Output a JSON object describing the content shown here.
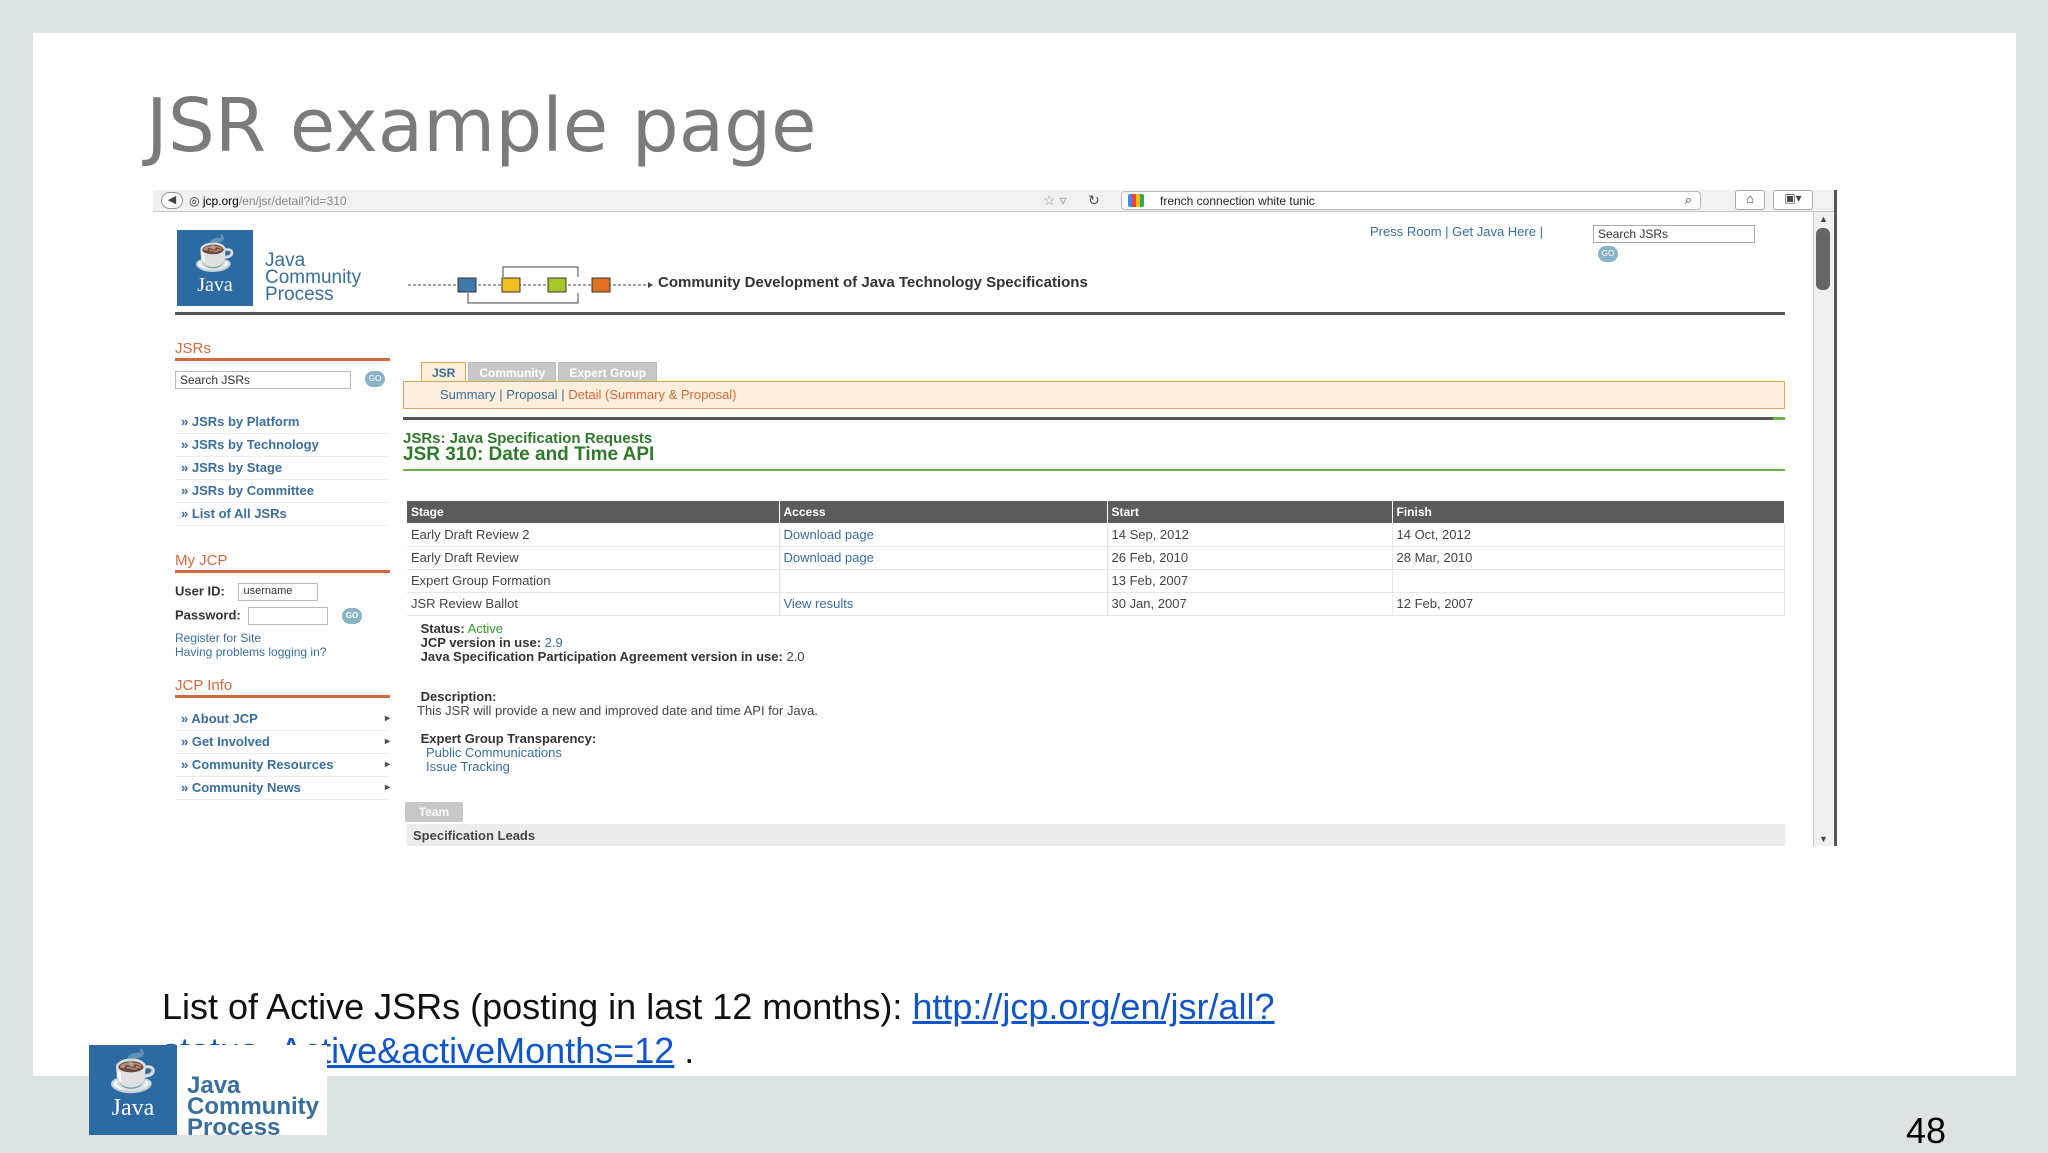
{
  "slide": {
    "title": "JSR example page",
    "page_number": "48",
    "caption_text": "List of Active JSRs (posting in last 12 months): ",
    "caption_link": "http://jcp.org/en/jsr/all?status=Active&activeMonths=12",
    "caption_end": " ."
  },
  "browser": {
    "url_host": "jcp.org",
    "url_path": "/en/jsr/detail?id=310",
    "search_query": "french connection white tunic"
  },
  "jcp": {
    "logo_text": "Java",
    "logo_words": [
      "Java",
      "Community",
      "Process"
    ],
    "tagline": "Community Development of Java Technology Specifications",
    "toplinks": [
      "Press Room",
      "Get Java Here"
    ],
    "search_placeholder": "Search JSRs",
    "go_label": "GO"
  },
  "sidebar": {
    "jsrs_heading": "JSRs",
    "search_placeholder": "Search JSRs",
    "jsr_links": [
      "» JSRs by Platform",
      "» JSRs by Technology",
      "» JSRs by Stage",
      "» JSRs by Committee",
      "» List of All JSRs"
    ],
    "myjcp_heading": "My JCP",
    "userid_label": "User ID:",
    "userid_value": "username",
    "password_label": "Password:",
    "register_link": "Register for Site",
    "problems_link": "Having problems logging in?",
    "jcpinfo_heading": "JCP Info",
    "info_links": [
      "» About JCP",
      "» Get Involved",
      "» Community Resources",
      "» Community News"
    ]
  },
  "main": {
    "tabs": [
      "JSR",
      "Community",
      "Expert Group"
    ],
    "subnav": [
      "Summary",
      "Proposal",
      "Detail (Summary & Proposal)"
    ],
    "kicker": "JSRs: Java Specification Requests",
    "title": "JSR 310: Date and Time API",
    "table_headers": [
      "Stage",
      "Access",
      "Start",
      "Finish"
    ],
    "rows": [
      [
        "Early Draft Review 2",
        "Download page",
        "14 Sep, 2012",
        "14 Oct, 2012"
      ],
      [
        "Early Draft Review",
        "Download page",
        "26 Feb, 2010",
        "28 Mar, 2010"
      ],
      [
        "Expert Group Formation",
        "",
        "13 Feb, 2007",
        ""
      ],
      [
        "JSR Review Ballot",
        "View results",
        "30 Jan, 2007",
        "12 Feb, 2007"
      ]
    ],
    "status_label": "Status:",
    "status_value": "Active",
    "jcp_version_label": "JCP version in use:",
    "jcp_version_value": "2.9",
    "jspa_label": "Java Specification Participation Agreement version in use:",
    "jspa_value": "2.0",
    "description_label": "Description:",
    "description_text": "This JSR will provide a new and improved date and time API for Java.",
    "transparency_label": "Expert Group Transparency:",
    "transparency_links": [
      "Public Communications",
      "Issue Tracking"
    ],
    "team_tab": "Team",
    "spec_leads": "Specification Leads"
  },
  "footer_logo": {
    "text": "Java",
    "words": [
      "Java",
      "Community",
      "Process"
    ]
  }
}
